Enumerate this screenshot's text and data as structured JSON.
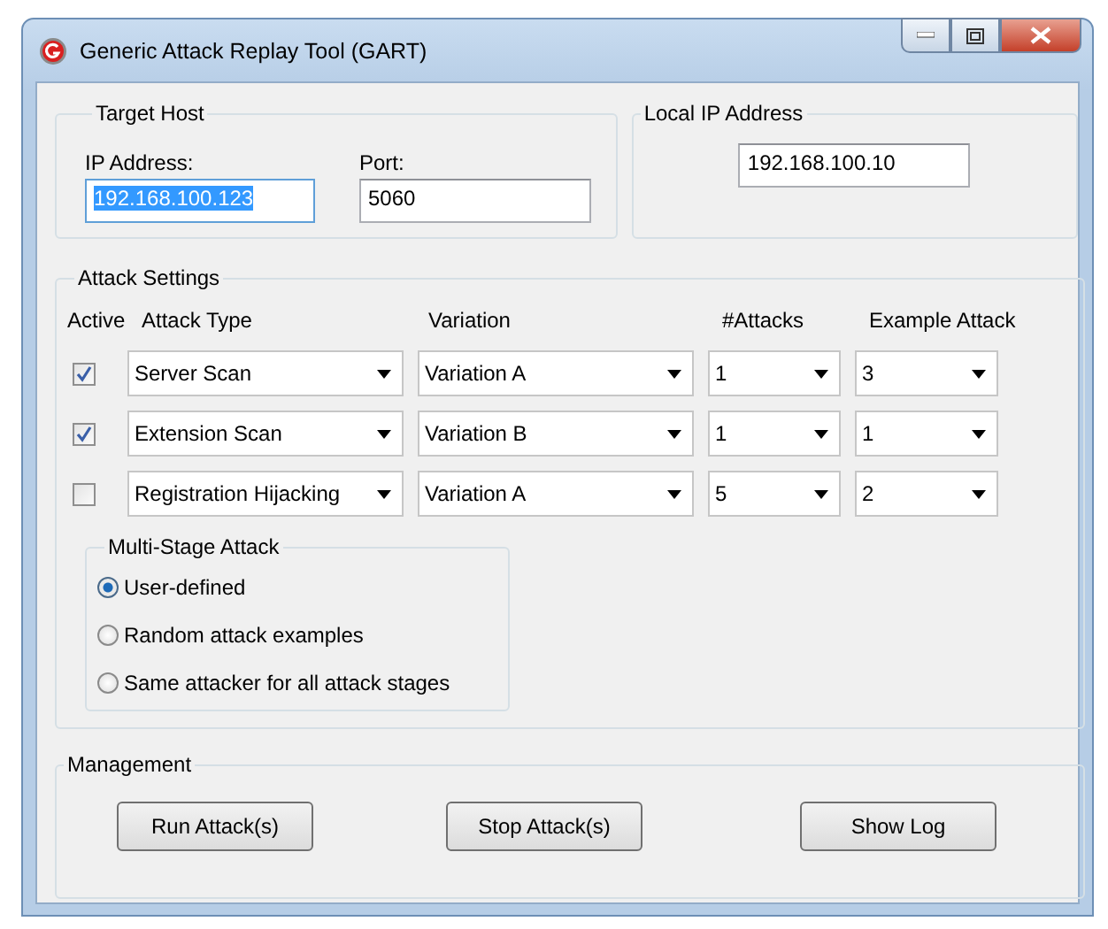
{
  "window": {
    "title": "Generic Attack Replay Tool (GART)"
  },
  "target_host": {
    "title": "Target Host",
    "ip_label": "IP Address:",
    "ip_value": "192.168.100.123",
    "ip_selected": true,
    "port_label": "Port:",
    "port_value": "5060"
  },
  "local_ip": {
    "title": "Local IP Address",
    "value": "192.168.100.10"
  },
  "attack_settings": {
    "title": "Attack Settings",
    "columns": [
      "Active",
      "Attack Type",
      "Variation",
      "#Attacks",
      "Example Attack"
    ],
    "rows": [
      {
        "checked": true,
        "attack_type": "Server Scan",
        "variation": "Variation A",
        "attacks": "1",
        "example": "3"
      },
      {
        "checked": true,
        "attack_type": "Extension Scan",
        "variation": "Variation B",
        "attacks": "1",
        "example": "1"
      },
      {
        "checked": false,
        "attack_type": "Registration Hijacking",
        "variation": "Variation A",
        "attacks": "5",
        "example": "2"
      }
    ],
    "multi_stage": {
      "title": "Multi-Stage Attack",
      "options": [
        {
          "label": "User-defined",
          "selected": true
        },
        {
          "label": "Random attack examples",
          "selected": false
        },
        {
          "label": "Same attacker for all attack stages",
          "selected": false
        }
      ]
    }
  },
  "management": {
    "title": "Management",
    "buttons": [
      "Run Attack(s)",
      "Stop Attack(s)",
      "Show Log"
    ]
  }
}
